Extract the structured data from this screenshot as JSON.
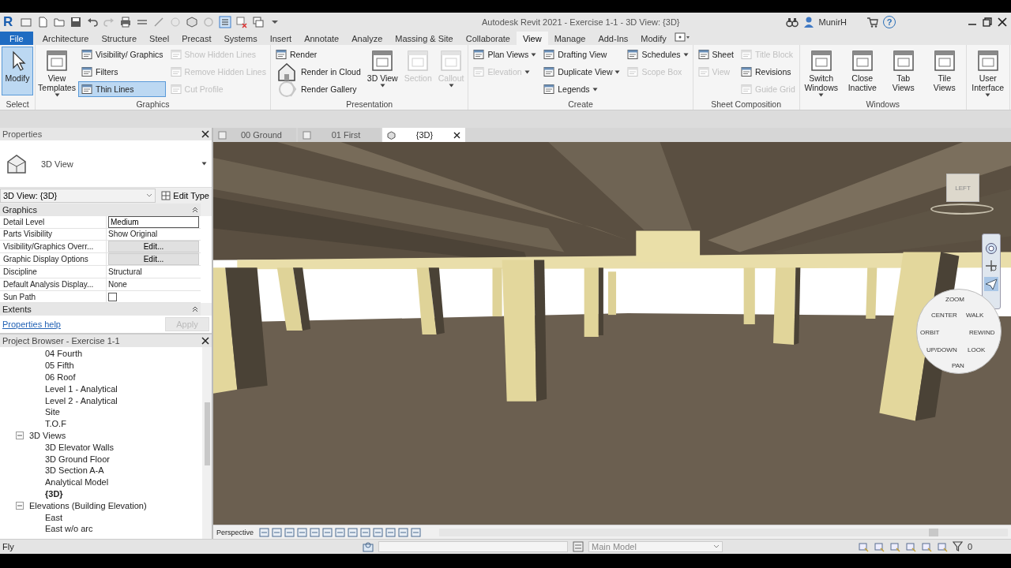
{
  "title_bar": {
    "logo": "R",
    "title": "Autodesk Revit 2021 - Exercise 1-1 - 3D View: {3D}",
    "user": "MunirH",
    "help": "?"
  },
  "menu_tabs": [
    {
      "label": "File",
      "kind": "file",
      "selected": false
    },
    {
      "label": "Architecture",
      "kind": "tab",
      "selected": false
    },
    {
      "label": "Structure",
      "kind": "tab",
      "selected": false
    },
    {
      "label": "Steel",
      "kind": "tab",
      "selected": false
    },
    {
      "label": "Precast",
      "kind": "tab",
      "selected": false
    },
    {
      "label": "Systems",
      "kind": "tab",
      "selected": false
    },
    {
      "label": "Insert",
      "kind": "tab",
      "selected": false
    },
    {
      "label": "Annotate",
      "kind": "tab",
      "selected": false
    },
    {
      "label": "Analyze",
      "kind": "tab",
      "selected": false
    },
    {
      "label": "Massing & Site",
      "kind": "tab",
      "selected": false
    },
    {
      "label": "Collaborate",
      "kind": "tab",
      "selected": false
    },
    {
      "label": "View",
      "kind": "tab",
      "selected": true
    },
    {
      "label": "Manage",
      "kind": "tab",
      "selected": false
    },
    {
      "label": "Add-Ins",
      "kind": "tab",
      "selected": false
    },
    {
      "label": "Modify",
      "kind": "tab",
      "selected": false
    }
  ],
  "ribbon_panels": [
    {
      "title": "Select",
      "columns": [
        [
          {
            "label": "Modify",
            "kind": "large",
            "active": true,
            "disabled": false,
            "dropdown": false
          }
        ]
      ]
    },
    {
      "title": "Graphics",
      "columns": [
        [
          {
            "label": "View Templates",
            "kind": "large",
            "active": false,
            "disabled": false,
            "dropdown": true
          }
        ],
        [
          {
            "label": "Visibility/ Graphics",
            "kind": "small",
            "active": false,
            "disabled": false,
            "dropdown": false
          },
          {
            "label": "Filters",
            "kind": "small",
            "active": false,
            "disabled": false,
            "dropdown": false
          },
          {
            "label": "Thin Lines",
            "kind": "small",
            "active": true,
            "disabled": false,
            "dropdown": false
          }
        ],
        [
          {
            "label": "Show Hidden Lines",
            "kind": "small",
            "active": false,
            "disabled": true,
            "dropdown": false
          },
          {
            "label": "Remove Hidden Lines",
            "kind": "small",
            "active": false,
            "disabled": true,
            "dropdown": false
          },
          {
            "label": "Cut Profile",
            "kind": "small",
            "active": false,
            "disabled": true,
            "dropdown": false
          }
        ]
      ]
    },
    {
      "title": "Presentation",
      "columns": [
        [
          {
            "label": "Render",
            "kind": "small",
            "active": false,
            "disabled": false,
            "dropdown": false
          },
          {
            "label": "Render in Cloud",
            "kind": "small",
            "active": false,
            "disabled": false,
            "dropdown": false
          },
          {
            "label": "Render Gallery",
            "kind": "small",
            "active": false,
            "disabled": false,
            "dropdown": false
          }
        ],
        [
          {
            "label": "3D View",
            "kind": "large",
            "active": false,
            "disabled": false,
            "dropdown": true
          }
        ],
        [
          {
            "label": "Section",
            "kind": "large",
            "active": false,
            "disabled": true,
            "dropdown": false
          }
        ],
        [
          {
            "label": "Callout",
            "kind": "large",
            "active": false,
            "disabled": true,
            "dropdown": true
          }
        ]
      ]
    },
    {
      "title": "Create",
      "columns": [
        [
          {
            "label": "Plan Views",
            "kind": "small",
            "active": false,
            "disabled": false,
            "dropdown": true
          },
          {
            "label": "Elevation",
            "kind": "small",
            "active": false,
            "disabled": true,
            "dropdown": true
          }
        ],
        [
          {
            "label": "Drafting View",
            "kind": "small",
            "active": false,
            "disabled": false,
            "dropdown": false
          },
          {
            "label": "Duplicate View",
            "kind": "small",
            "active": false,
            "disabled": false,
            "dropdown": true
          },
          {
            "label": "Legends",
            "kind": "small",
            "active": false,
            "disabled": false,
            "dropdown": true
          }
        ],
        [
          {
            "label": "Schedules",
            "kind": "small",
            "active": false,
            "disabled": false,
            "dropdown": true
          },
          {
            "label": "Scope Box",
            "kind": "small",
            "active": false,
            "disabled": true,
            "dropdown": false
          }
        ]
      ]
    },
    {
      "title": "Sheet Composition",
      "columns": [
        [
          {
            "label": "Sheet",
            "kind": "small",
            "active": false,
            "disabled": false,
            "dropdown": false
          },
          {
            "label": "View",
            "kind": "small",
            "active": false,
            "disabled": true,
            "dropdown": false
          }
        ],
        [
          {
            "label": "Title Block",
            "kind": "small",
            "active": false,
            "disabled": true,
            "dropdown": false
          },
          {
            "label": "Revisions",
            "kind": "small",
            "active": false,
            "disabled": false,
            "dropdown": false
          },
          {
            "label": "Guide Grid",
            "kind": "small",
            "active": false,
            "disabled": true,
            "dropdown": false
          }
        ]
      ]
    },
    {
      "title": "Windows",
      "columns": [
        [
          {
            "label": "Switch Windows",
            "kind": "large",
            "active": false,
            "disabled": false,
            "dropdown": true
          }
        ],
        [
          {
            "label": "Close Inactive",
            "kind": "large",
            "active": false,
            "disabled": false,
            "dropdown": false
          }
        ],
        [
          {
            "label": "Tab Views",
            "kind": "large",
            "active": false,
            "disabled": false,
            "dropdown": false
          }
        ],
        [
          {
            "label": "Tile Views",
            "kind": "large",
            "active": false,
            "disabled": false,
            "dropdown": false
          }
        ]
      ]
    },
    {
      "columns": [
        [
          {
            "label": "User Interface",
            "kind": "large",
            "active": false,
            "disabled": false,
            "dropdown": true
          }
        ]
      ]
    }
  ],
  "properties": {
    "title": "Properties",
    "type_name": "3D View",
    "instance": "3D View: {3D}",
    "edit_type": "Edit Type",
    "sections": [
      {
        "title": "Graphics",
        "rows": [
          {
            "name": "Detail Level",
            "kind": "field",
            "value": "Medium"
          },
          {
            "name": "Parts Visibility",
            "kind": "text",
            "value": "Show Original"
          },
          {
            "name": "Visibility/Graphics Overr...",
            "kind": "button",
            "value": "Edit..."
          },
          {
            "name": "Graphic Display Options",
            "kind": "button",
            "value": "Edit..."
          },
          {
            "name": "Discipline",
            "kind": "text",
            "value": "Structural"
          },
          {
            "name": "Default Analysis Display...",
            "kind": "text",
            "value": "None"
          },
          {
            "name": "Sun Path",
            "kind": "checkbox",
            "checked": false
          }
        ]
      },
      {
        "title": "Extents"
      }
    ],
    "help_link": "Properties help",
    "apply": {
      "label": "Apply",
      "disabled": true
    }
  },
  "project_browser": {
    "title": "Project Browser - Exercise 1-1",
    "tree": [
      {
        "children": [
          {
            "label": "04 Fourth",
            "current": false
          },
          {
            "label": "05 Fifth",
            "current": false
          },
          {
            "label": "06 Roof",
            "current": false
          },
          {
            "label": "Level 1 - Analytical",
            "current": false
          },
          {
            "label": "Level 2 - Analytical",
            "current": false
          },
          {
            "label": "Site",
            "current": false
          },
          {
            "label": "T.O.F",
            "current": false
          }
        ]
      },
      {
        "label": "3D Views",
        "expanded": true,
        "children": [
          {
            "label": "3D Elevator Walls",
            "current": false
          },
          {
            "label": "3D Ground Floor",
            "current": false
          },
          {
            "label": "3D Section A-A",
            "current": false
          },
          {
            "label": "Analytical Model",
            "current": false
          },
          {
            "label": "{3D}",
            "current": true
          }
        ]
      },
      {
        "label": "Elevations (Building Elevation)",
        "expanded": true,
        "children": [
          {
            "label": "East",
            "current": false
          },
          {
            "label": "East w/o arc",
            "current": false
          }
        ]
      }
    ]
  },
  "view_tabs": [
    {
      "label": "00 Ground",
      "selected": false
    },
    {
      "label": "01 First",
      "selected": false
    },
    {
      "label": "{3D}",
      "selected": true
    }
  ],
  "viewport": {
    "view_cube": "LEFT",
    "wheel_labels": [
      "ZOOM",
      "CENTER",
      "WALK",
      "ORBIT",
      "REWIND",
      "UP/DOWN",
      "LOOK",
      "PAN"
    ],
    "view_control": "Perspective"
  },
  "status_bar": {
    "message": "Fly",
    "model": "Main Model",
    "filter_count": "0"
  }
}
